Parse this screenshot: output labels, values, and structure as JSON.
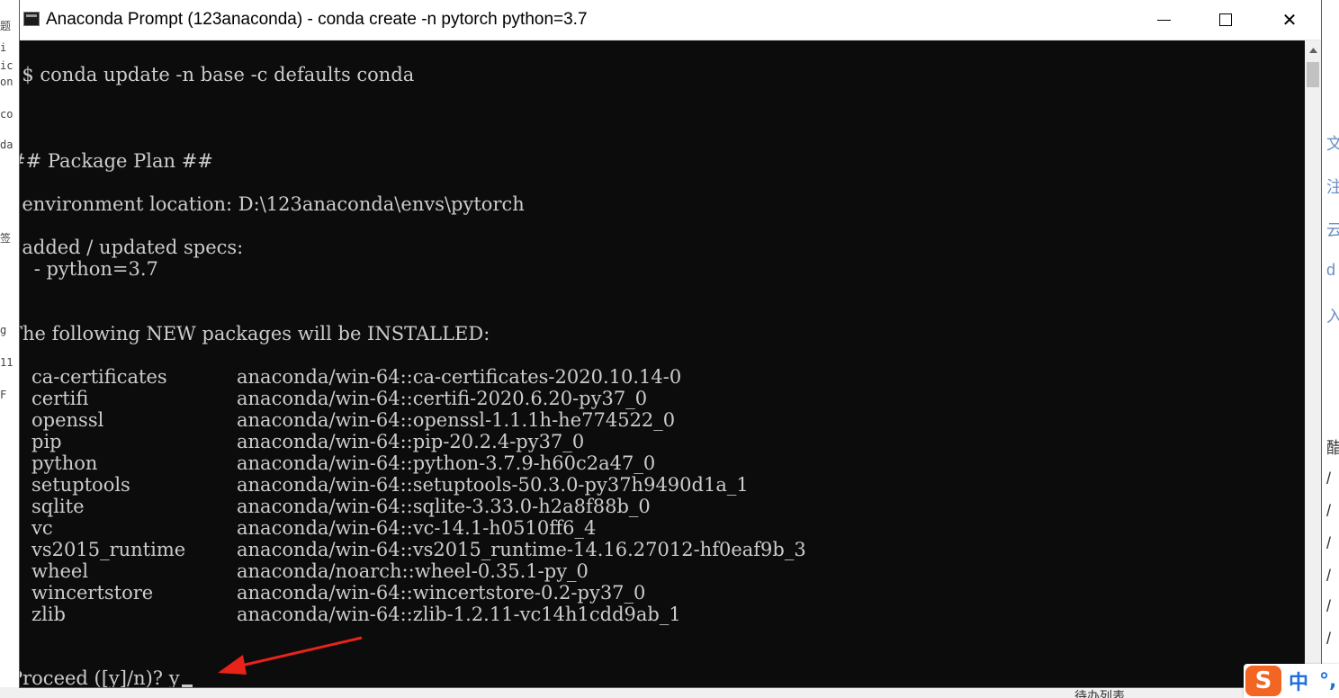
{
  "window": {
    "title": "Anaconda Prompt (123anaconda) - conda  create -n pytorch python=3.7",
    "close_glyph": "✕"
  },
  "console": {
    "update_cmd": "  $ conda update -n base -c defaults conda",
    "plan_header": "## Package Plan ##",
    "env_location": "  environment location: D:\\123anaconda\\envs\\pytorch",
    "specs_header": "  added / updated specs:",
    "spec_item": "    - python=3.7",
    "install_header": "The following NEW packages will be INSTALLED:",
    "packages": [
      {
        "name": "ca-certificates",
        "source": "anaconda/win-64::ca-certificates-2020.10.14-0"
      },
      {
        "name": "certifi",
        "source": "anaconda/win-64::certifi-2020.6.20-py37_0"
      },
      {
        "name": "openssl",
        "source": "anaconda/win-64::openssl-1.1.1h-he774522_0"
      },
      {
        "name": "pip",
        "source": "anaconda/win-64::pip-20.2.4-py37_0"
      },
      {
        "name": "python",
        "source": "anaconda/win-64::python-3.7.9-h60c2a47_0"
      },
      {
        "name": "setuptools",
        "source": "anaconda/win-64::setuptools-50.3.0-py37h9490d1a_1"
      },
      {
        "name": "sqlite",
        "source": "anaconda/win-64::sqlite-3.33.0-h2a8f88b_0"
      },
      {
        "name": "vc",
        "source": "anaconda/win-64::vc-14.1-h0510ff6_4"
      },
      {
        "name": "vs2015_runtime",
        "source": "anaconda/win-64::vs2015_runtime-14.16.27012-hf0eaf9b_3"
      },
      {
        "name": "wheel",
        "source": "anaconda/noarch::wheel-0.35.1-py_0"
      },
      {
        "name": "wincertstore",
        "source": "anaconda/win-64::wincertstore-0.2-py37_0"
      },
      {
        "name": "zlib",
        "source": "anaconda/win-64::zlib-1.2.11-vc14h1cdd9ab_1"
      }
    ],
    "prompt": "Proceed ([y]/n)? ",
    "input": "y"
  },
  "ime": {
    "logo": "S",
    "lang": "中",
    "punct": "°,"
  },
  "background": {
    "left_fragments": [
      "题",
      "i",
      "ic",
      "on",
      "co",
      "da",
      "签",
      "g",
      "11",
      "F"
    ],
    "right_fragments": [
      "文",
      "注",
      "云",
      "d",
      "入",
      "醋",
      "/",
      "/",
      "/",
      "/",
      "/",
      "/"
    ],
    "bottom_text": "待办列表"
  },
  "colors": {
    "console_bg": "#0c0c0c",
    "console_fg": "#cccccc",
    "arrow": "#e8231a"
  }
}
